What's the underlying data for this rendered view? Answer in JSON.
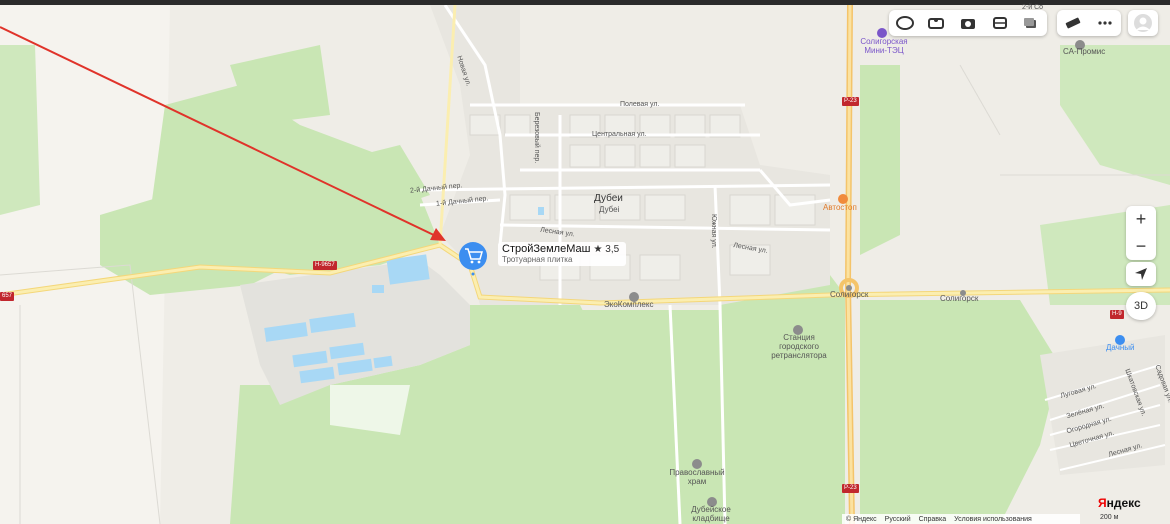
{
  "toolbar": {
    "icons": [
      "layers-icon",
      "panorama-icon",
      "camera-icon",
      "transit-icon",
      "map-mode-icon"
    ],
    "ruler_icon": "ruler-icon",
    "more_icon": "more-icon"
  },
  "controls": {
    "zoom_in": "+",
    "zoom_out": "−",
    "btn_3d": "3D"
  },
  "place_card": {
    "title": "СтройЗемлеМаш",
    "rating": "★ 3,5",
    "subtitle": "Тротуарная плитка"
  },
  "town": {
    "name": "Дубеи",
    "sub": "Дубеі"
  },
  "streets": {
    "novaya": "Новая ул.",
    "polevaya": "Полевая ул.",
    "berezovy": "Березовый пер.",
    "centralnaya": "Центральная ул.",
    "dachny2": "2-й Дачный пер.",
    "dachny1": "1-й Дачный пер.",
    "lesnaya1": "Лесная ул.",
    "yuzhnaya": "Южная ул.",
    "lesnaya2": "Лесная ул.",
    "lugovaya": "Луговая ул.",
    "zelenaya": "Зелёная ул.",
    "ogorodnaya": "Огородная ул.",
    "tsvetochnaya": "Цветочная ул.",
    "lesnaya3": "Лесная ул.",
    "shkolnaya": "Шкатовская ул.",
    "sadovaya": "Садовая ул.",
    "top_right": "2-й Со"
  },
  "pois": {
    "mini_tec": "Солигорская Мини-ТЭЦ",
    "sa_promis": "СА-Промис",
    "avtostop": "Автостоп",
    "ekokompleks": "ЭкоКомплекс",
    "soligorsk_stop": "Солигорск",
    "soligorsk": "Солигорск",
    "station": "Станция городского ретранслятора",
    "church": "Православный храм",
    "cemetery": "Дубейское кладбище",
    "dachny": "Дачный"
  },
  "roads": {
    "h9657": "Н-9657",
    "h9657_left": "657",
    "p23_top": "Р-23",
    "p23_bottom": "Р-23",
    "h9_right": "Н-9"
  },
  "footer": {
    "yandex": "© Яндекс",
    "lang": "Русский",
    "help": "Справка",
    "terms": "Условия использования"
  },
  "scale": "200 м",
  "brand": {
    "ya": "Я",
    "ndex": "ндекс"
  },
  "colors": {
    "forest": "#c8e6b4",
    "field": "#f4f2ec",
    "road_yellow": "#f7e08c",
    "water": "#a8d8f5",
    "arrow": "#e0332a",
    "pin": "#3c8ef0"
  }
}
